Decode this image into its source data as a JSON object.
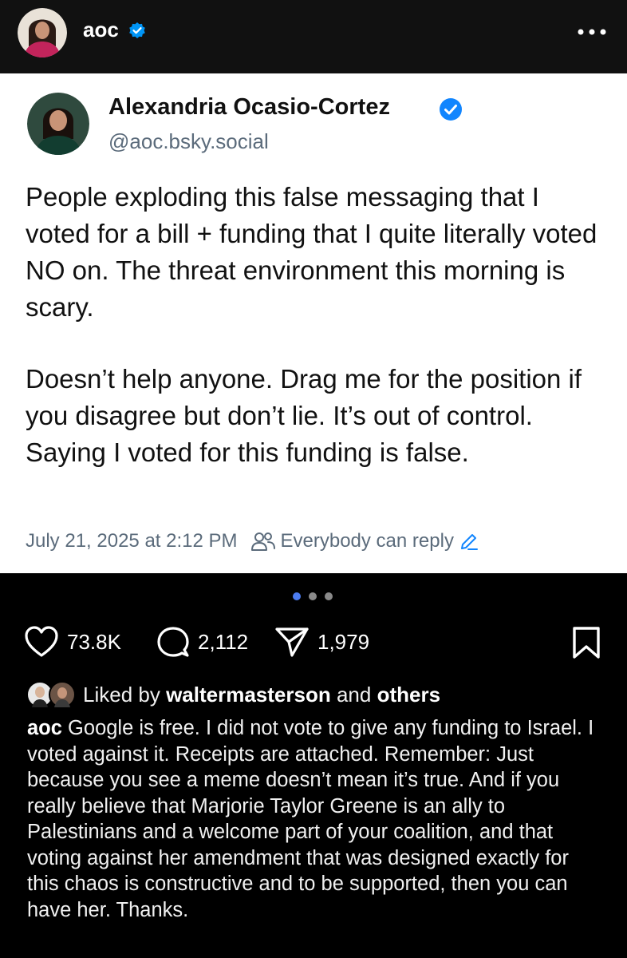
{
  "header": {
    "username": "aoc",
    "verified_icon": "verified-badge-icon",
    "more_icon": "more-horizontal-icon"
  },
  "post_card": {
    "author_name": "Alexandria Ocasio-Cortez",
    "author_handle": "@aoc.bsky.social",
    "paragraphs": [
      "People exploding this false messaging that I voted for a bill + funding that I quite literally voted NO on. The threat environment this morning is scary.",
      "Doesn’t help anyone. Drag me for the position if you disagree but don’t lie. It’s out of control. Saying I voted for this funding is false."
    ],
    "timestamp": "July 21, 2025 at 2:12 PM",
    "reply_setting": "Everybody can reply"
  },
  "carousel": {
    "current_index": 1,
    "total": 3
  },
  "actions": {
    "likes_count": "73.8K",
    "comments_count": "2,112",
    "shares_count": "1,979"
  },
  "liked_by": {
    "prefix": "Liked by",
    "user": "waltermasterson",
    "middle": "and",
    "others": "others"
  },
  "caption": {
    "username": "aoc",
    "text": "Google is free. I did not vote to give any funding to Israel. I voted against it. Receipts are attached. Remember: Just because you see a meme doesn’t mean it’s true. And if you really believe that Marjorie Taylor Greene is an ally to Palestinians and a welcome part of your coalition, and that voting against her amendment that was designed exactly for this chaos is constructive and to be supported, then you can have her. Thanks."
  },
  "colors": {
    "verified_blue": "#0095f6",
    "bluesky_verified": "#1185fe",
    "meta_gray": "#5b6b7b",
    "active_dot": "#4c7cf0"
  }
}
